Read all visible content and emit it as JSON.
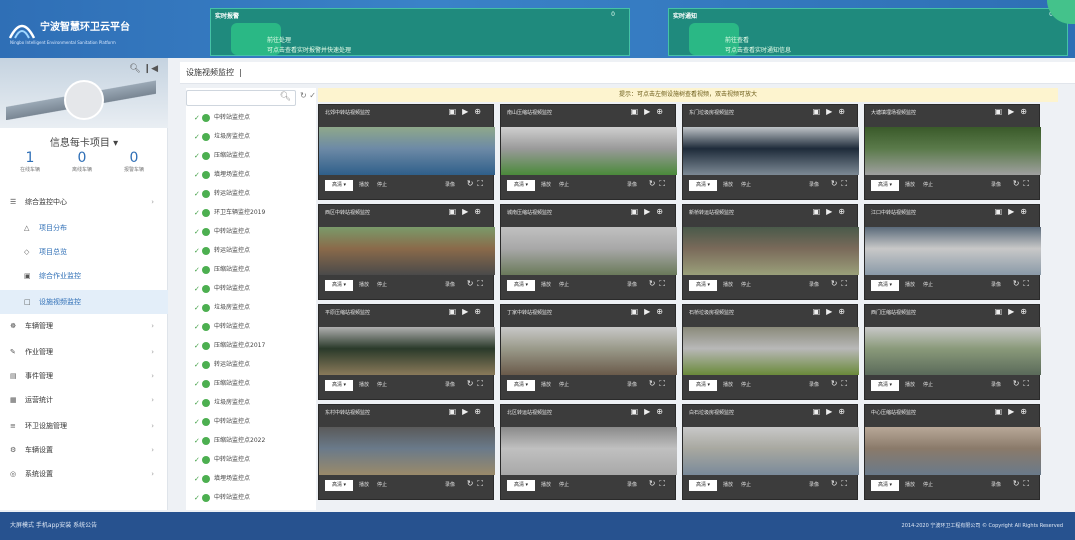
{
  "header": {
    "logo_title": "宁波智慧环卫云平台",
    "logo_subtitle": "Ningbo Intelligent Environmental Sanitation Platform",
    "banners": [
      {
        "title": "实时报警",
        "status": "0",
        "line1": "前往处理",
        "line2": "可点击查看实时报警并快速处理"
      },
      {
        "title": "实时通知",
        "status": "0",
        "line1": "前往查看",
        "line2": "可点击查看实时通知信息"
      }
    ]
  },
  "sidebar": {
    "user_name": "信息每卡项目",
    "stats": [
      {
        "value": "1",
        "label": "在线车辆"
      },
      {
        "value": "0",
        "label": "离线车辆"
      },
      {
        "value": "0",
        "label": "报警车辆"
      }
    ],
    "items": [
      {
        "label": "综合监控中心",
        "icon": "monitor-icon"
      },
      {
        "label": "项目分布",
        "icon": "map-icon"
      },
      {
        "label": "项目总览",
        "icon": "overview-icon"
      },
      {
        "label": "综合作业监控",
        "icon": "work-icon"
      },
      {
        "label": "设施视频监控",
        "icon": "camera-icon"
      },
      {
        "label": "车辆管理",
        "icon": "car-icon"
      },
      {
        "label": "作业管理",
        "icon": "task-icon"
      },
      {
        "label": "事件管理",
        "icon": "event-icon"
      },
      {
        "label": "运营统计",
        "icon": "stats-icon"
      },
      {
        "label": "环卫设施管理",
        "icon": "facility-icon"
      },
      {
        "label": "车辆设置",
        "icon": "vehicle-settings-icon"
      },
      {
        "label": "系统设置",
        "icon": "settings-icon"
      }
    ]
  },
  "tabs": [
    {
      "label": "设施视频监控"
    }
  ],
  "tree": {
    "search_placeholder": "",
    "nodes": [
      "中转站监控点",
      "垃圾房监控点",
      "压缩站监控点",
      "填埋场监控点",
      "转运站监控点",
      "环卫车辆监控2019",
      "中转站监控点",
      "转运站监控点",
      "压缩站监控点",
      "中转站监控点",
      "垃圾房监控点",
      "中转站监控点",
      "压缩站监控点2017",
      "转运站监控点",
      "压缩站监控点",
      "垃圾房监控点",
      "中转站监控点",
      "压缩站监控点2022",
      "中转站监控点",
      "填埋场监控点",
      "中转站监控点"
    ]
  },
  "notice": "提示：可点击左侧设施树查看视频，双击视频可放大",
  "cells": [
    {
      "title": "北郊中转站视频监控"
    },
    {
      "title": "南山压缩站视频监控"
    },
    {
      "title": "东门垃圾房视频监控"
    },
    {
      "title": "大塘填埋场视频监控"
    },
    {
      "title": "西区中转站视频监控"
    },
    {
      "title": "城南压缩站视频监控"
    },
    {
      "title": "新桥转运站视频监控"
    },
    {
      "title": "江口中转站视频监控"
    },
    {
      "title": "平原压缩站视频监控"
    },
    {
      "title": "丁家中转站视频监控"
    },
    {
      "title": "石桥垃圾房视频监控"
    },
    {
      "title": "西门压缩站视频监控"
    },
    {
      "title": "东村中转站视频监控"
    },
    {
      "title": "北区转运站视频监控"
    },
    {
      "title": "白石垃圾房视频监控"
    },
    {
      "title": "中心压缩站视频监控"
    }
  ],
  "cell_controls": {
    "quality": "高清",
    "play": "播放",
    "stop": "停止",
    "record": "录像"
  },
  "footer": {
    "left": "大屏模式    手机app安装    系统公告",
    "right": "2014-2020 宁波环卫工程有限公司 © Copyright All Rights Reserved"
  }
}
